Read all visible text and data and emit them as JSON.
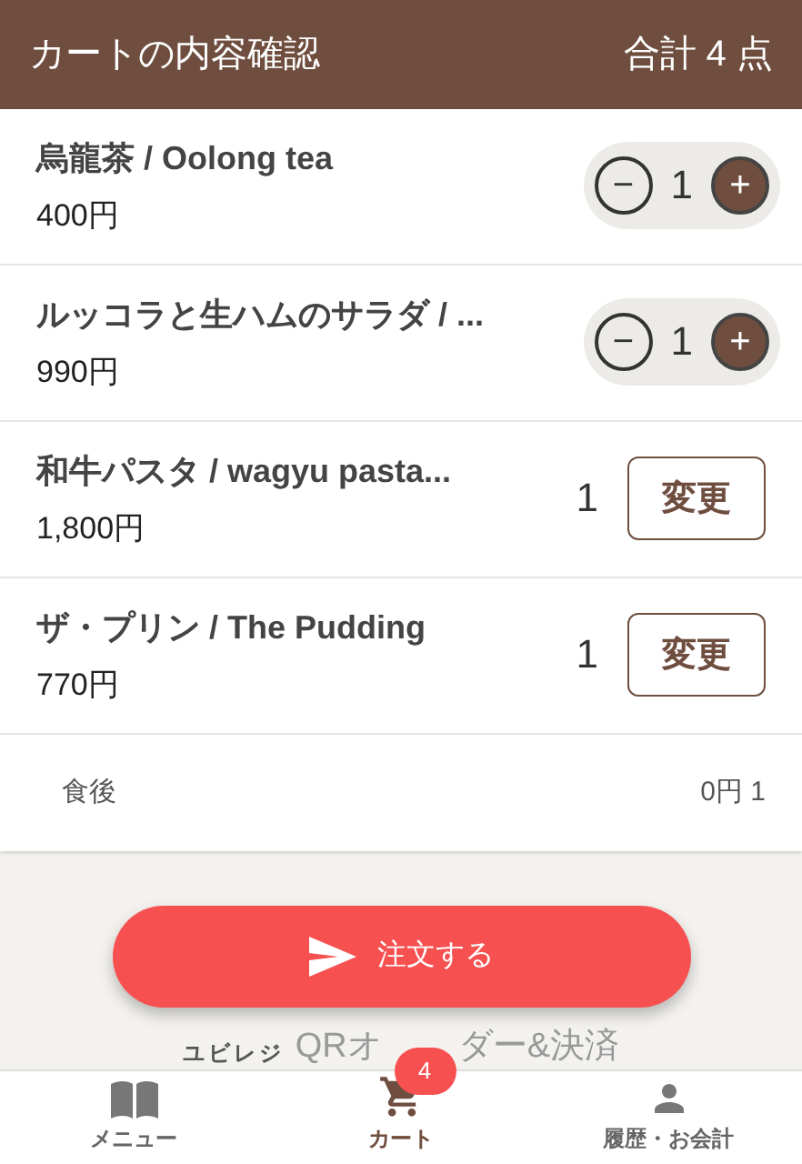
{
  "header": {
    "title": "カートの内容確認",
    "total": "合計 4 点"
  },
  "items": [
    {
      "kind": "stepper",
      "name": "烏龍茶 / Oolong tea",
      "price": "400円",
      "quantity": "1",
      "minus": "−",
      "plus": "+"
    },
    {
      "kind": "stepper",
      "name": "ルッコラと生ハムのサラダ / ...",
      "price": "990円",
      "quantity": "1",
      "minus": "−",
      "plus": "+"
    },
    {
      "kind": "fixed",
      "name": "和牛パスタ / wagyu pasta...",
      "price": "1,800円",
      "quantity": "1",
      "action": "変更"
    },
    {
      "kind": "fixed",
      "name": "ザ・プリン / The Pudding",
      "price": "770円",
      "quantity": "1",
      "action": "変更"
    },
    {
      "kind": "option",
      "name": "食後",
      "price": "0円 1"
    }
  ],
  "order_button": {
    "label": "注文する"
  },
  "logo": {
    "brand": "ユビレジ",
    "text_before": "QRオ",
    "text_after": "ダー&決済"
  },
  "nav": [
    {
      "label": "メニュー",
      "kind": "book",
      "selected": false
    },
    {
      "label": "カート",
      "kind": "cart",
      "selected": true,
      "badge": "4"
    },
    {
      "label": "履歴・お会計",
      "kind": "person",
      "selected": false
    }
  ]
}
